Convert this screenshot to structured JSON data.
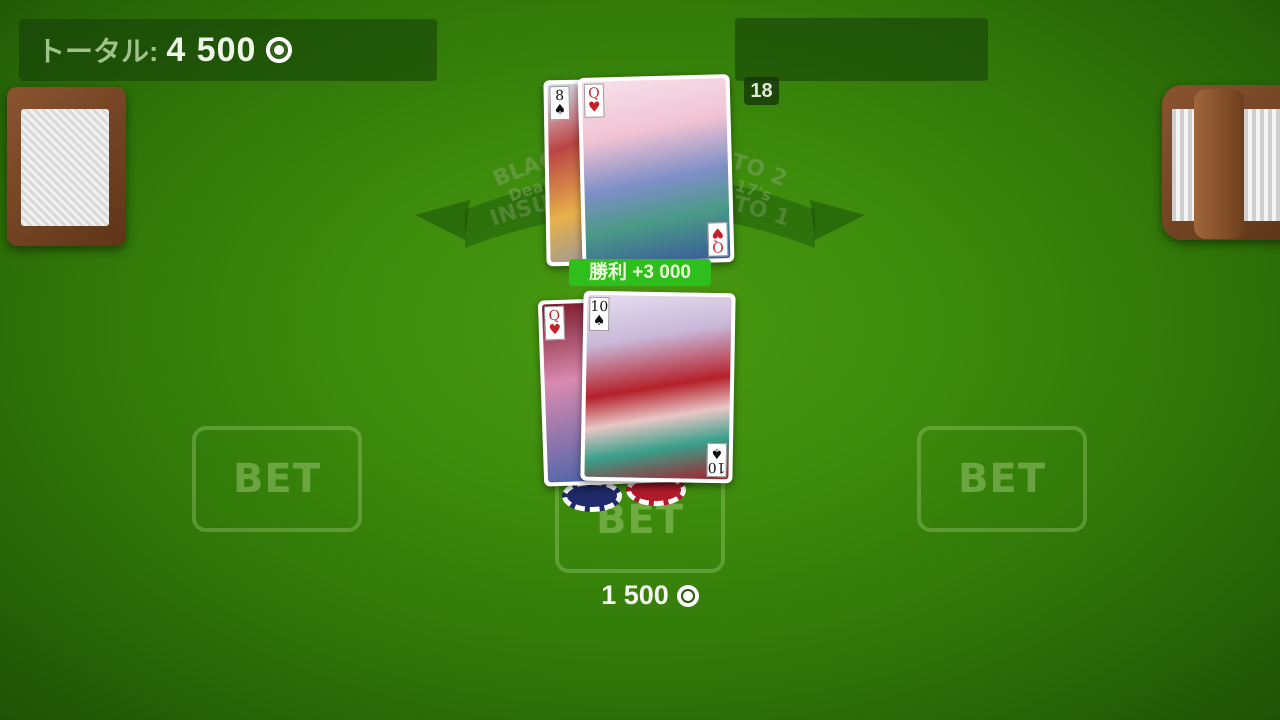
{
  "header": {
    "total_label": "トータル:",
    "total_value": "4 500"
  },
  "dealer": {
    "hand_total": "18",
    "cards": [
      {
        "rank": "8",
        "suit": "♠",
        "color": "black"
      },
      {
        "rank": "Q",
        "suit": "♥",
        "color": "red"
      }
    ]
  },
  "player": {
    "result_badge": "勝利 +3 000",
    "cards": [
      {
        "rank": "Q",
        "suit": "♥",
        "color": "red"
      },
      {
        "rank": "10",
        "suit": "♠",
        "color": "black"
      }
    ],
    "bet_amount": "1 500"
  },
  "table": {
    "ribbon_line1": "BLACKJACK PAYS 3 TO 2",
    "ribbon_line2": "Dealer must stand on all 17's",
    "ribbon_line3": "INSURANCE PAYS 2 TO 1",
    "bet_boxes": [
      "BET",
      "BET",
      "BET"
    ]
  },
  "colors": {
    "felt": "#3c8a0c",
    "win_badge": "#2fbf1c",
    "chip_blue": "#1f2a6b",
    "chip_red": "#b11a2a"
  }
}
